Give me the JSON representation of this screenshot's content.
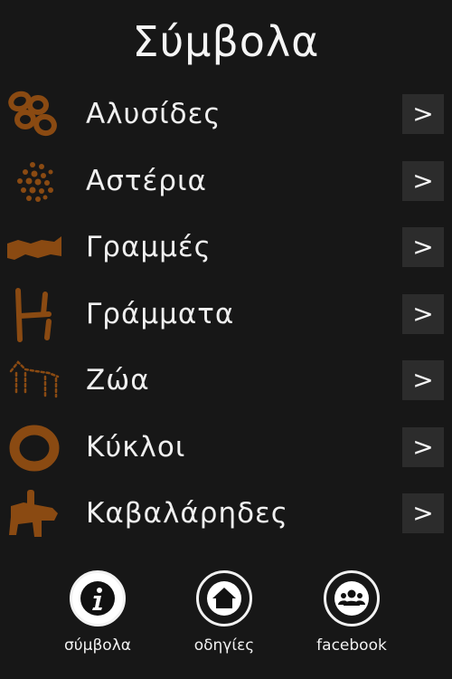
{
  "header": {
    "title": "Σύμβολα"
  },
  "symbols": [
    {
      "label": "Αλυσίδες",
      "icon": "chain-symbol-icon",
      "arrow": ">"
    },
    {
      "label": "Αστέρια",
      "icon": "stars-symbol-icon",
      "arrow": ">"
    },
    {
      "label": "Γραμμές",
      "icon": "lines-symbol-icon",
      "arrow": ">"
    },
    {
      "label": "Γράμματα",
      "icon": "letters-symbol-icon",
      "arrow": ">"
    },
    {
      "label": "Ζώα",
      "icon": "animal-symbol-icon",
      "arrow": ">"
    },
    {
      "label": "Κύκλοι",
      "icon": "circle-symbol-icon",
      "arrow": ">"
    },
    {
      "label": "Καβαλάρηδες",
      "icon": "rider-symbol-icon",
      "arrow": ">"
    }
  ],
  "bottom_nav": [
    {
      "label": "σύμβολα",
      "icon": "info-icon",
      "active": true
    },
    {
      "label": "οδηγίες",
      "icon": "home-icon",
      "active": false
    },
    {
      "label": "facebook",
      "icon": "group-icon",
      "active": false
    }
  ],
  "colors": {
    "background": "#171717",
    "icon_brown": "#8a4a12",
    "arrow_bg": "#2c2c2c",
    "text": "#f2f2f2"
  }
}
